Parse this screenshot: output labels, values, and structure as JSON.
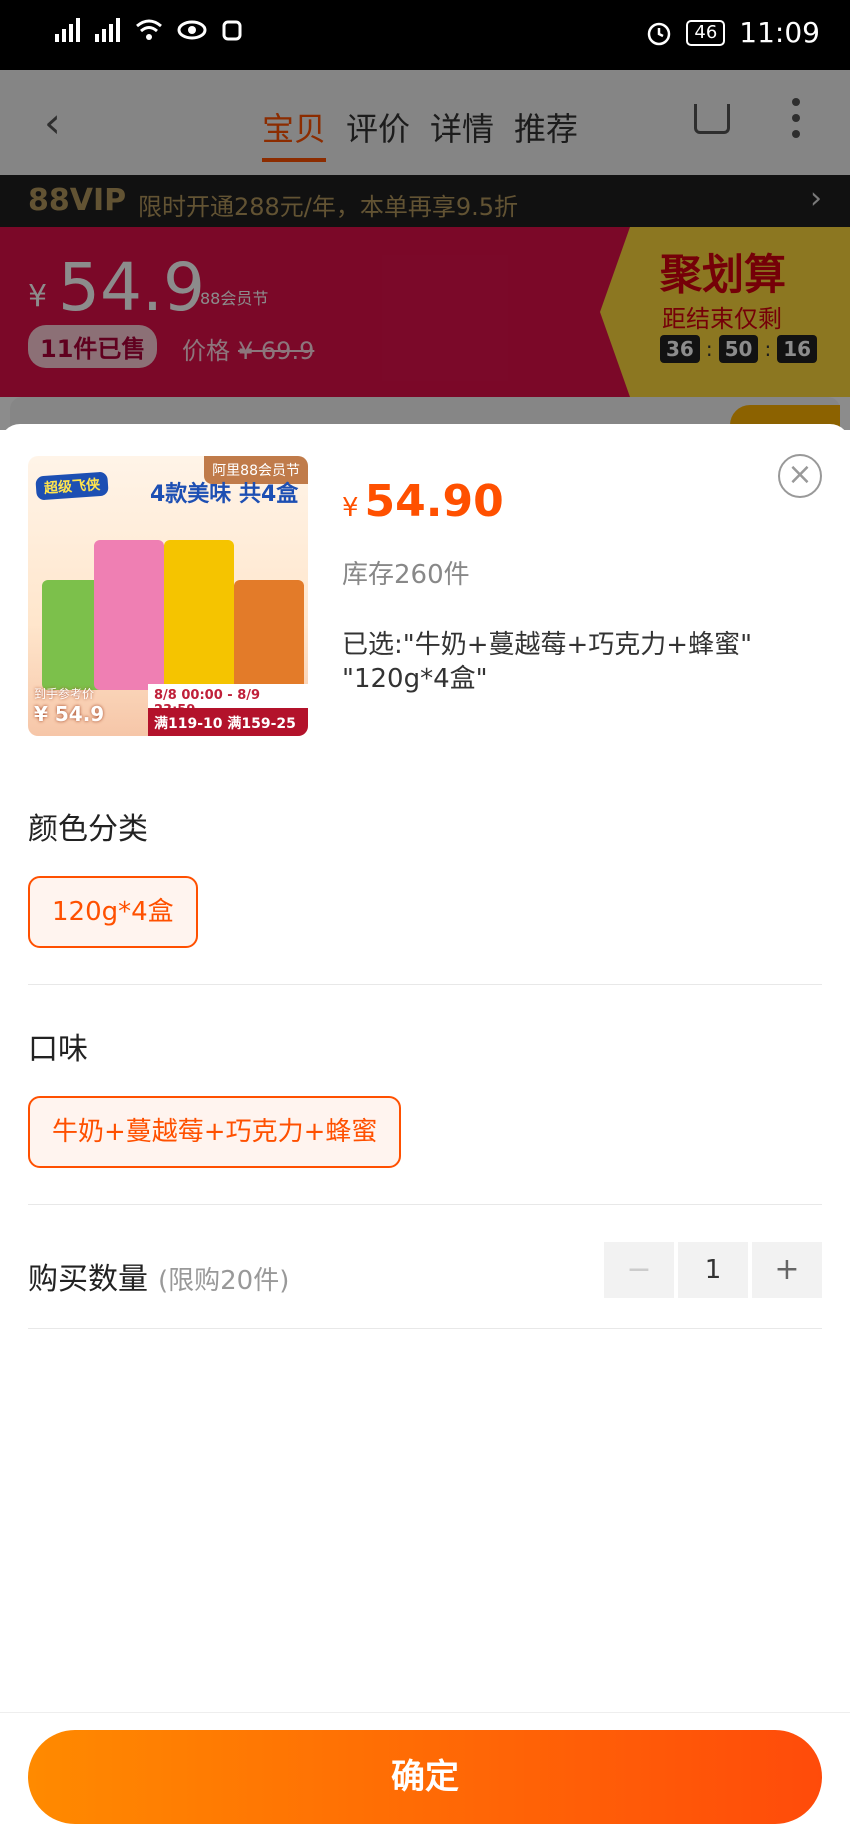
{
  "status_bar": {
    "time": "11:09",
    "battery": "46"
  },
  "header": {
    "tabs": [
      "宝贝",
      "评价",
      "详情",
      "推荐"
    ]
  },
  "vip_bar": {
    "brand": "88VIP",
    "text": "限时开通288元/年，本单再享9.5折"
  },
  "price_band": {
    "currency": "¥",
    "price": "54.9",
    "tag": "88会员节",
    "sold": "11件已售",
    "orig_label": "价格",
    "orig_price": "¥ 69.9"
  },
  "juhuasuan": {
    "title": "聚划算",
    "subtitle": "距结束仅剩",
    "hh": "36",
    "mm": "50",
    "ss": "16"
  },
  "thumbnail": {
    "badge": "阿里88会员节",
    "logo": "超级飞侠",
    "headline": "4款美味 共4盒",
    "promo_time": "8/8 00:00 - 8/9 23:59",
    "promo_discount": "满119-10 满159-25",
    "ref_label": "到手参考价",
    "ref_price": "¥ 54.9"
  },
  "sku": {
    "currency": "¥",
    "price": "54.90",
    "stock": "库存260件",
    "chosen_line1": "已选:\"牛奶+蔓越莓+巧克力+蜂蜜\"",
    "chosen_line2": "\"120g*4盒\""
  },
  "color_section": {
    "title": "颜色分类",
    "option": "120g*4盒"
  },
  "flavor_section": {
    "title": "口味",
    "option": "牛奶+蔓越莓+巧克力+蜂蜜"
  },
  "quantity": {
    "label": "购买数量",
    "limit": "(限购20件)",
    "value": "1",
    "minus": "−",
    "plus": "+"
  },
  "confirm_label": "确定",
  "colors": {
    "accent": "#ff5000",
    "band": "#e0104a",
    "juhuasuan": "#ffd93c"
  }
}
